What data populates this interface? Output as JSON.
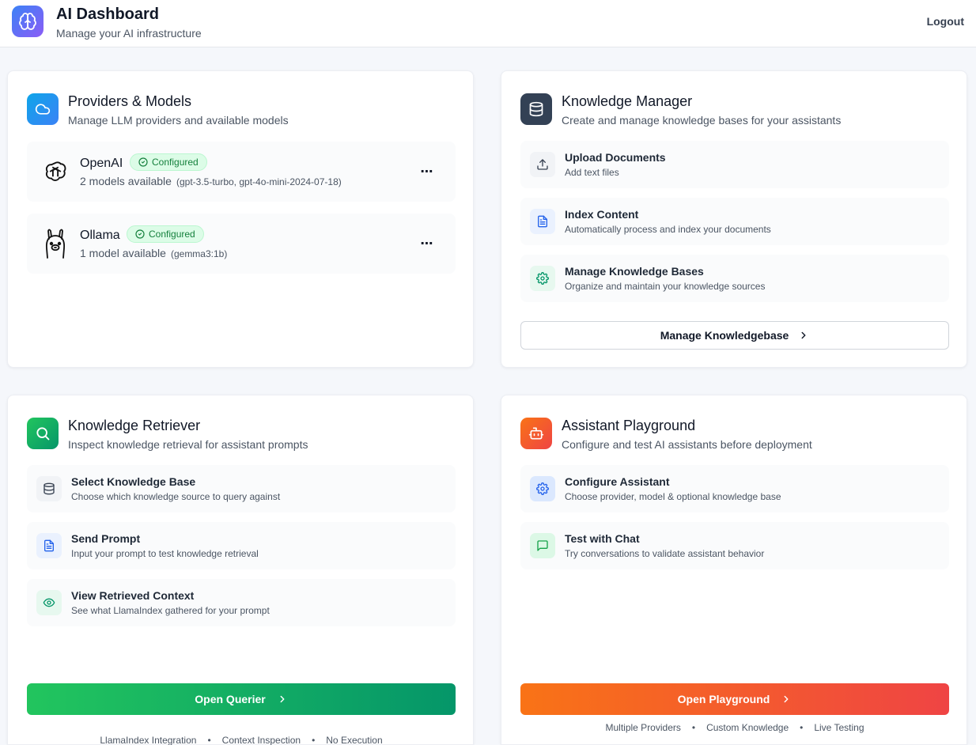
{
  "header": {
    "title": "AI Dashboard",
    "subtitle": "Manage your AI infrastructure",
    "logout_label": "Logout"
  },
  "providers": {
    "title": "Providers & Models",
    "subtitle": "Manage LLM providers and available models",
    "items": [
      {
        "name": "OpenAI",
        "status": "Configured",
        "models_count": "2 models available",
        "models_detail": "(gpt-3.5-turbo, gpt-4o-mini-2024-07-18)",
        "more": "⋯"
      },
      {
        "name": "Ollama",
        "status": "Configured",
        "models_count": "1 model available",
        "models_detail": "(gemma3:1b)",
        "more": "⋯"
      }
    ]
  },
  "knowledge_manager": {
    "title": "Knowledge Manager",
    "subtitle": "Create and manage knowledge bases for your assistants",
    "items": [
      {
        "title": "Upload Documents",
        "desc": "Add text files"
      },
      {
        "title": "Index Content",
        "desc": "Automatically process and index your documents"
      },
      {
        "title": "Manage Knowledge Bases",
        "desc": "Organize and maintain your knowledge sources"
      }
    ],
    "button_label": "Manage Knowledgebase"
  },
  "knowledge_retriever": {
    "title": "Knowledge Retriever",
    "subtitle": "Inspect knowledge retrieval for assistant prompts",
    "items": [
      {
        "title": "Select Knowledge Base",
        "desc": "Choose which knowledge source to query against"
      },
      {
        "title": "Send Prompt",
        "desc": "Input your prompt to test knowledge retrieval"
      },
      {
        "title": "View Retrieved Context",
        "desc": "See what LlamaIndex gathered for your prompt"
      }
    ],
    "button_label": "Open Querier",
    "tags": [
      "LlamaIndex Integration",
      "Context Inspection",
      "No Execution"
    ]
  },
  "assistant_playground": {
    "title": "Assistant Playground",
    "subtitle": "Configure and test AI assistants before deployment",
    "items": [
      {
        "title": "Configure Assistant",
        "desc": "Choose provider, model & optional knowledge base"
      },
      {
        "title": "Test with Chat",
        "desc": "Try conversations to validate assistant behavior"
      }
    ],
    "button_label": "Open Playground",
    "tags": [
      "Multiple Providers",
      "Custom Knowledge",
      "Live Testing"
    ]
  },
  "tag_separator": "•",
  "colors": {
    "logo_gradient": [
      "#3b82f6",
      "#8b5cf6"
    ],
    "providers_icon": [
      "#0ea5e9",
      "#3b82f6"
    ],
    "knowledge_icon": "#334155",
    "retriever_gradient": [
      "#22c55e",
      "#059669"
    ],
    "playground_gradient": [
      "#f97316",
      "#ef4444"
    ],
    "configured_badge": "#dcfce7"
  }
}
